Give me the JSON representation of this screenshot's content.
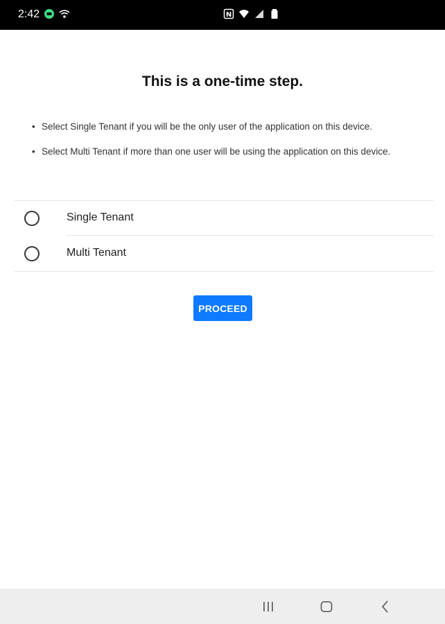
{
  "status_bar": {
    "time": "2:42",
    "left_icons": [
      "messages-icon",
      "wifi-calling-icon"
    ],
    "right_icons": [
      "nfc-icon",
      "wifi-icon",
      "signal-icon",
      "battery-icon"
    ]
  },
  "main": {
    "title": "This is a one-time step.",
    "bullets": [
      "Select Single Tenant if you will be the only user of the application on this device.",
      "Select Multi Tenant if more than one user will be using the application on this device."
    ],
    "options": [
      {
        "label": "Single Tenant",
        "selected": false
      },
      {
        "label": "Multi Tenant",
        "selected": false
      }
    ],
    "proceed_label": "PROCEED",
    "accent_color": "#0d7aff"
  },
  "nav_bar": {
    "buttons": [
      "recents-icon",
      "home-icon",
      "back-icon"
    ]
  }
}
